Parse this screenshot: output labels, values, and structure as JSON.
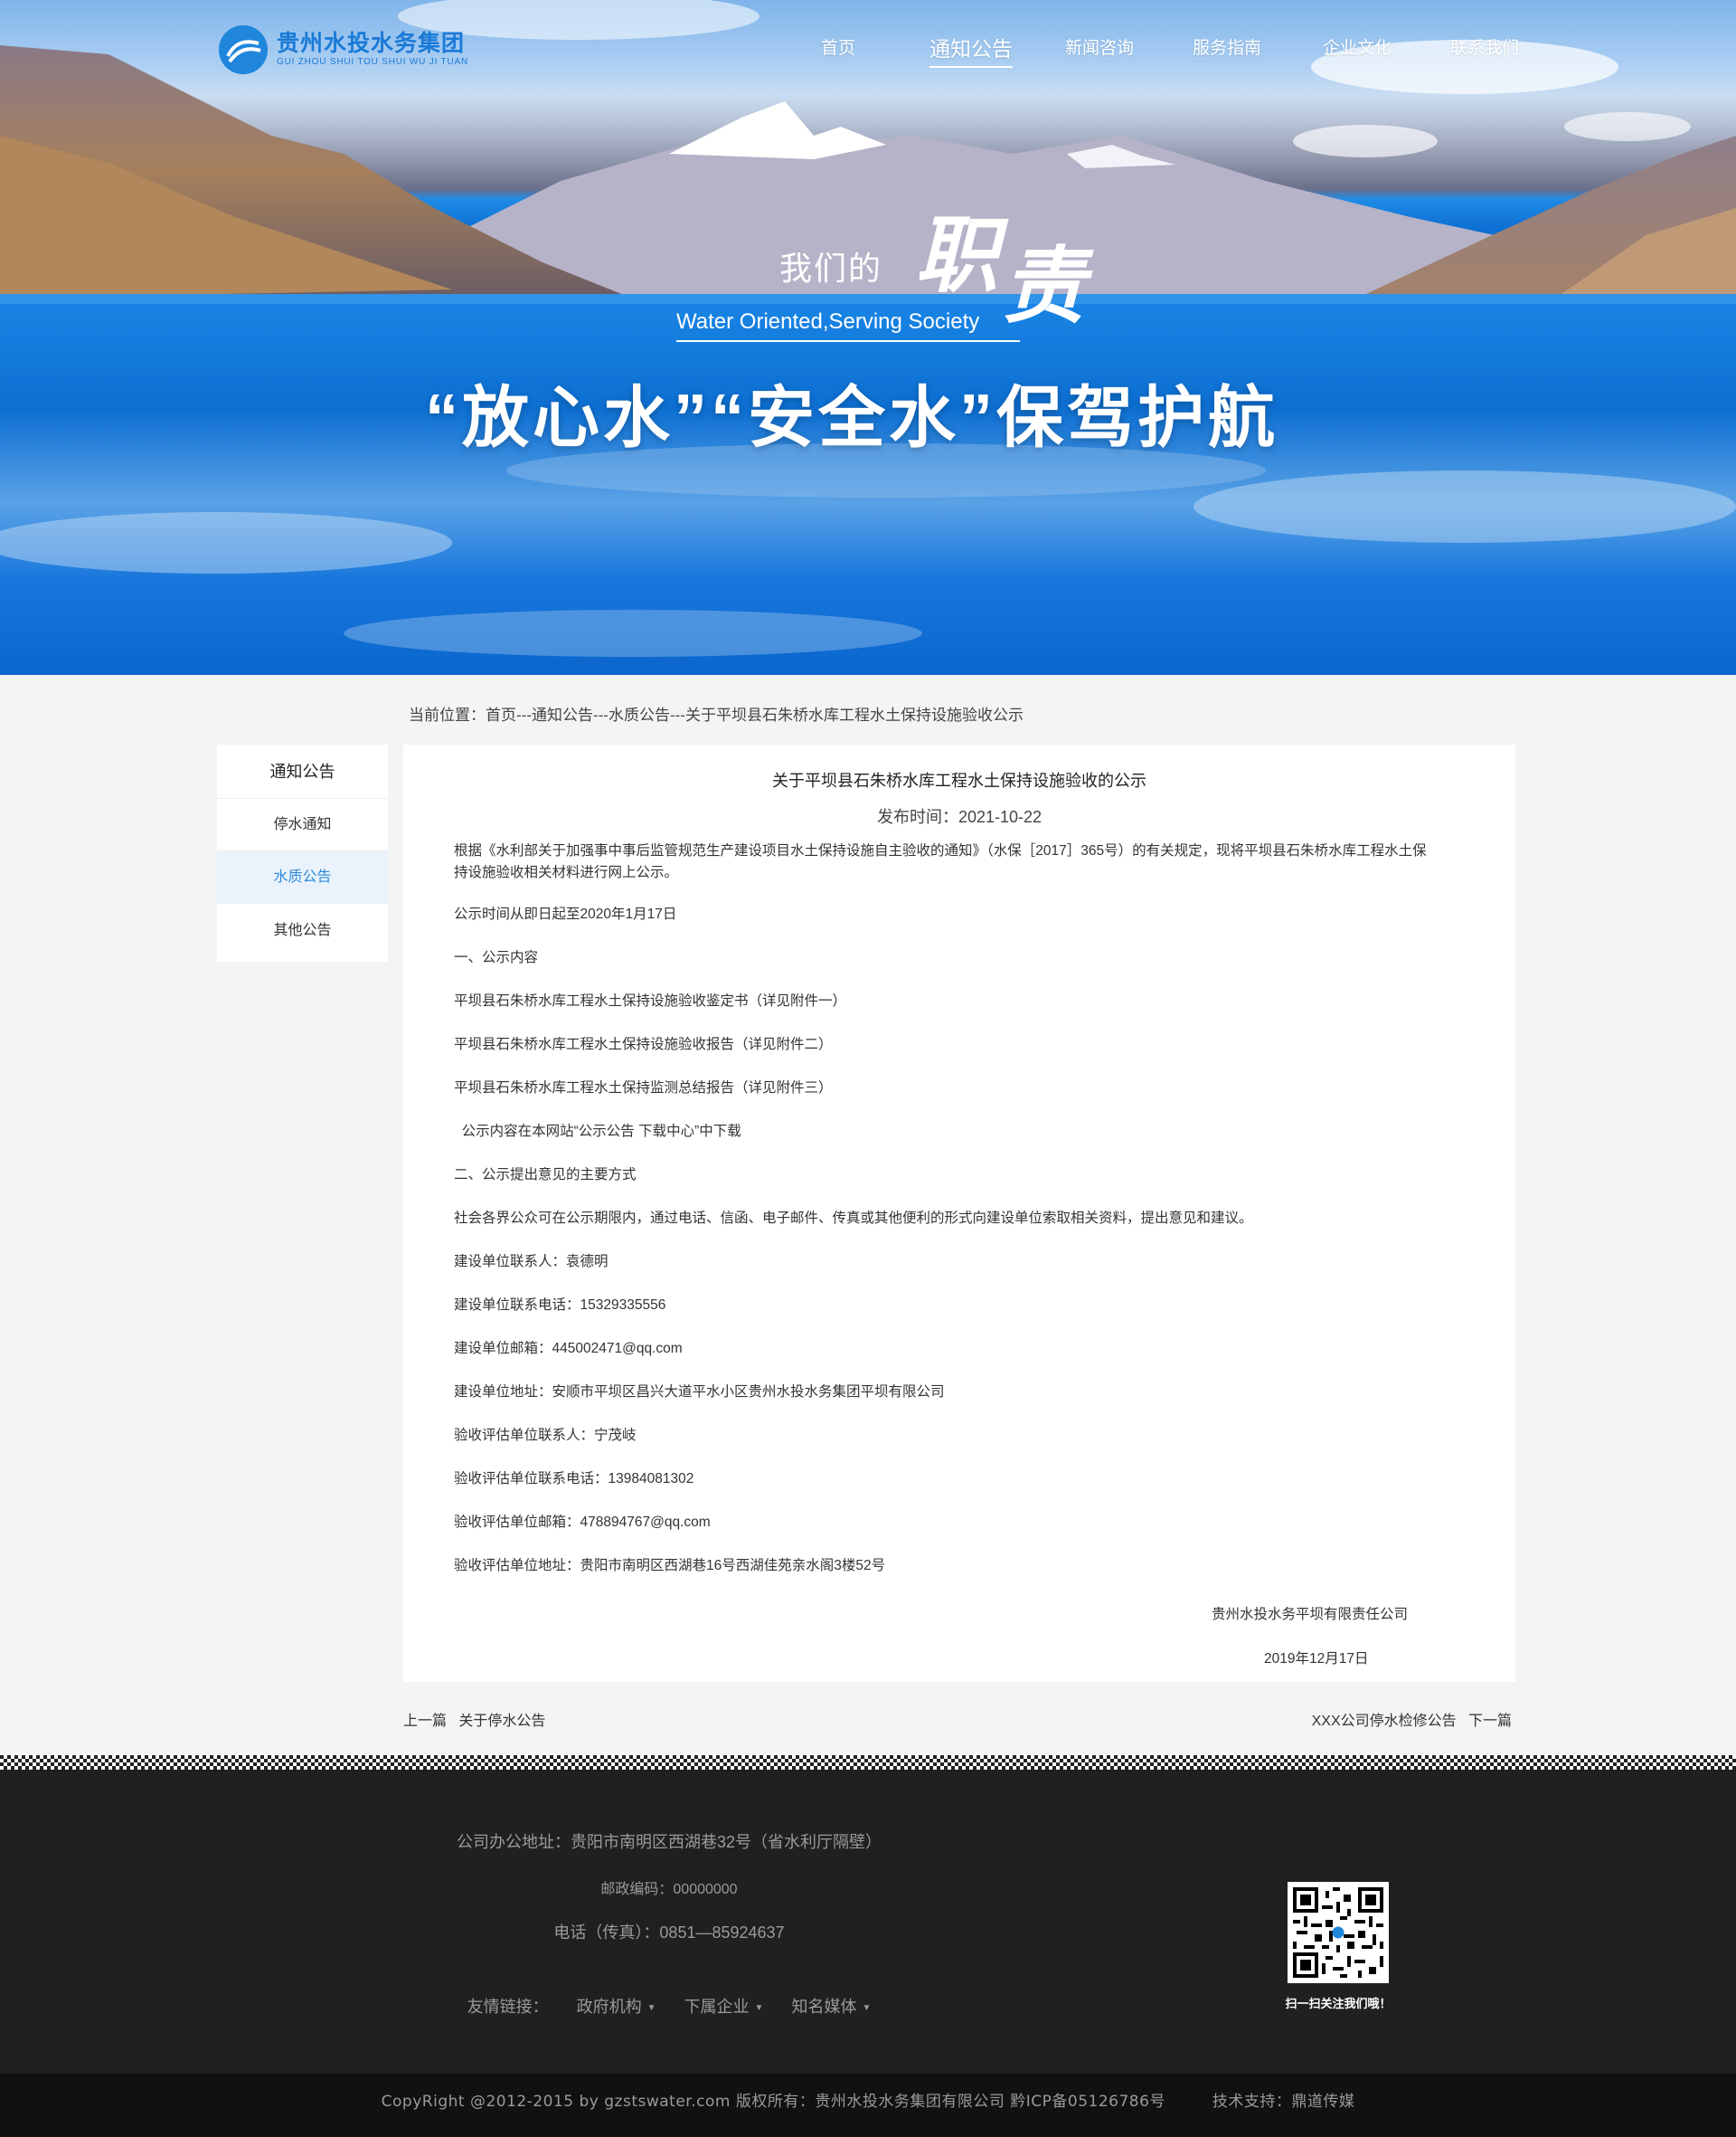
{
  "brand": {
    "name_cn": "贵州水投水务集团",
    "name_en": "GUI ZHOU SHUI TOU SHUI WU JI TUAN",
    "color": "#1f86dc"
  },
  "nav": {
    "items": [
      {
        "label": "首页",
        "active": false
      },
      {
        "label": "通知公告",
        "active": true
      },
      {
        "label": "新闻咨询",
        "active": false
      },
      {
        "label": "服务指南",
        "active": false
      },
      {
        "label": "企业文化",
        "active": false
      },
      {
        "label": "联系我们",
        "active": false
      }
    ]
  },
  "banner": {
    "slogan_small": "我们的",
    "slogan_big_1": "职",
    "slogan_big_2": "责",
    "slogan_en": "Water Oriented,Serving Society",
    "slogan_main": "“放心水”“安全水”保驾护航"
  },
  "breadcrumb": "当前位置：首页---通知公告---水质公告---关于平坝县石朱桥水库工程水土保持设施验收公示",
  "sidebar": {
    "title": "通知公告",
    "items": [
      {
        "label": "停水通知",
        "active": false
      },
      {
        "label": "水质公告",
        "active": true
      },
      {
        "label": "其他公告",
        "active": false
      }
    ]
  },
  "article": {
    "title": "关于平坝县石朱桥水库工程水土保持设施验收的公示",
    "date": "发布时间：2021-10-22",
    "intro_1": "根据《水利部关于加强事中事后监管规范生产建设项目水土保持设施自主验收的通知》（水保［2017］365号）的有关规定，现将平坝县石朱桥水库工程水土保",
    "intro_2": "持设施验收相关材料进行网上公示。",
    "paragraphs": [
      "公示时间从即日起至2020年1月17日",
      "一、公示内容",
      "平坝县石朱桥水库工程水土保持设施验收鉴定书（详见附件一）",
      "平坝县石朱桥水库工程水土保持设施验收报告（详见附件二）",
      "平坝县石朱桥水库工程水土保持监测总结报告（详见附件三）",
      "  公示内容在本网站“公示公告 下载中心”中下载",
      "二、公示提出意见的主要方式",
      "社会各界公众可在公示期限内，通过电话、信函、电子邮件、传真或其他便利的形式向建设单位索取相关资料，提出意见和建议。",
      "建设单位联系人：袁德明",
      "建设单位联系电话：15329335556",
      "建设单位邮箱：445002471@qq.com",
      "建设单位地址：安顺市平坝区昌兴大道平水小区贵州水投水务集团平坝有限公司",
      "验收评估单位联系人：宁茂岐",
      "验收评估单位联系电话：13984081302",
      "验收评估单位邮箱：478894767@qq.com",
      "验收评估单位地址：贵阳市南明区西湖巷16号西湖佳苑亲水阁3楼52号"
    ],
    "signature_org": "贵州水投水务平坝有限责任公司",
    "signature_date": "2019年12月17日"
  },
  "pager": {
    "prev_label": "上一篇",
    "prev_title": "关于停水公告",
    "next_title": "XXX公司停水检修公告",
    "next_label": "下一篇"
  },
  "footer": {
    "address": "公司办公地址：贵阳市南明区西湖巷32号（省水利厅隔壁）",
    "postcode": "邮政编码：00000000",
    "phone": "电话（传真）：0851—85924637",
    "links_label": "友情链接：",
    "links": [
      "政府机构",
      "下属企业",
      "知名媒体"
    ],
    "qr_caption": "扫一扫关注我们哦！",
    "copyright": "CopyRight @2012-2015 by gzstswater.com 版权所有：贵州水投水务集团有限公司   黔ICP备05126786号",
    "tech": "技术支持：鼎道传媒"
  }
}
